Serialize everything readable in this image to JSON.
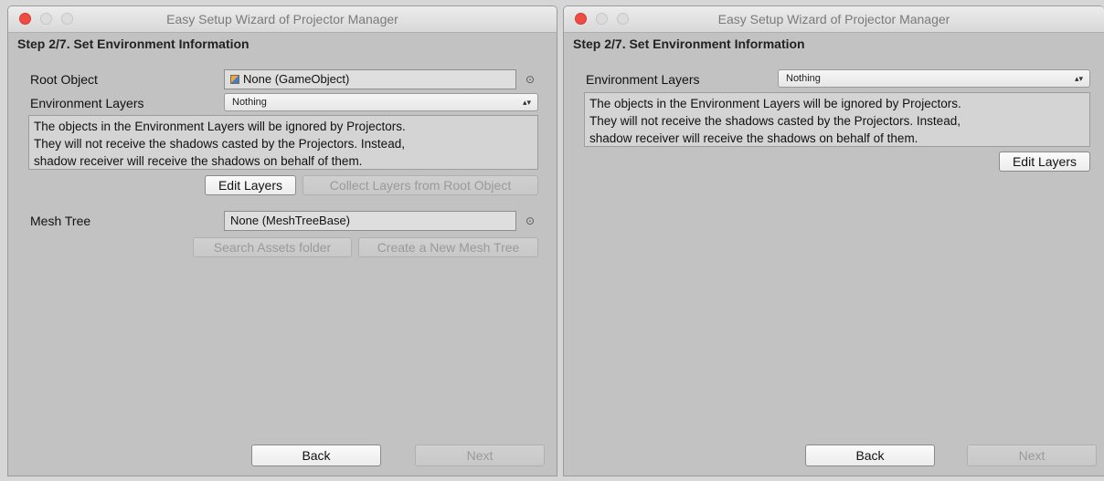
{
  "left_window": {
    "title": "Easy Setup Wizard of Projector Manager",
    "step_title": "Step 2/7. Set Environment Information",
    "root_object": {
      "label": "Root Object",
      "value": "None (GameObject)",
      "picker_icon": "target-icon"
    },
    "environment_layers": {
      "label": "Environment Layers",
      "value": "Nothing"
    },
    "help_lines": [
      "The objects in the Environment Layers will be ignored by Projectors.",
      "They will not receive the shadows casted by the Projectors. Instead,",
      "shadow receiver will receive the shadows on behalf of them."
    ],
    "edit_layers_label": "Edit Layers",
    "collect_layers_label": "Collect Layers from Root Object",
    "mesh_tree": {
      "label": "Mesh Tree",
      "value": "None (MeshTreeBase)",
      "picker_icon": "target-icon"
    },
    "search_assets_label": "Search Assets folder",
    "create_mesh_tree_label": "Create a New Mesh Tree",
    "back_label": "Back",
    "next_label": "Next"
  },
  "right_window": {
    "title": "Easy Setup Wizard of Projector Manager",
    "step_title": "Step 2/7. Set Environment Information",
    "environment_layers": {
      "label": "Environment Layers",
      "value": "Nothing"
    },
    "help_lines": [
      "The objects in the Environment Layers will be ignored by Projectors.",
      "They will not receive the shadows casted by the Projectors. Instead,",
      "shadow receiver will receive the shadows on behalf of them."
    ],
    "edit_layers_label": "Edit Layers",
    "back_label": "Back",
    "next_label": "Next"
  },
  "colors": {
    "window_bg": "#c2c2c2",
    "close_button": "#ee4b44",
    "disabled_text": "#9a9a9a"
  }
}
